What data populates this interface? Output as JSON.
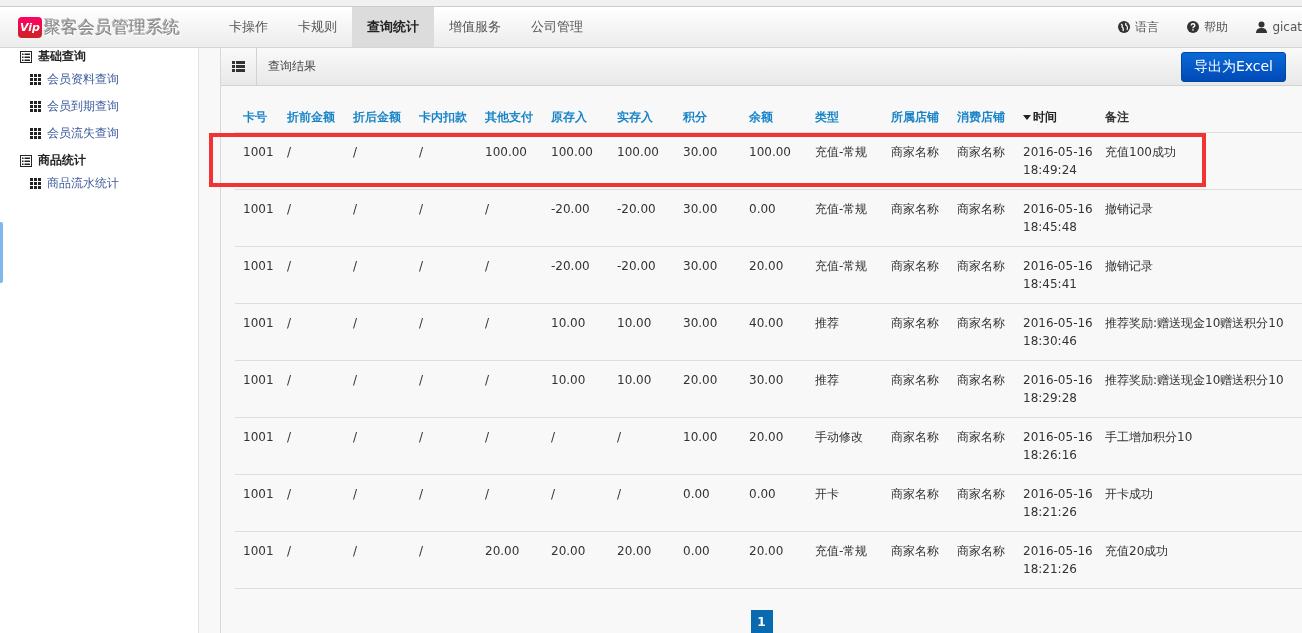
{
  "navbar": {
    "logo_badge": "Vip",
    "brand": "聚客会员管理系统",
    "tabs": [
      {
        "label": "卡操作",
        "selected": false
      },
      {
        "label": "卡规则",
        "selected": false
      },
      {
        "label": "查询统计",
        "selected": true
      },
      {
        "label": "增值服务",
        "selected": false
      },
      {
        "label": "公司管理",
        "selected": false
      }
    ],
    "right_items": [
      {
        "kind": "globe",
        "label": "语言"
      },
      {
        "kind": "help",
        "label": "帮助"
      },
      {
        "kind": "user",
        "label": "gicat"
      }
    ]
  },
  "sidebar": {
    "groups": [
      {
        "title": "基础查询",
        "items": [
          {
            "label": "会员资料查询"
          },
          {
            "label": "会员到期查询"
          },
          {
            "label": "会员流失查询"
          }
        ]
      },
      {
        "title": "商品统计",
        "items": [
          {
            "label": "商品流水统计"
          }
        ]
      }
    ]
  },
  "main": {
    "title": "查询结果",
    "export_button": "导出为Excel",
    "table": {
      "columns": [
        {
          "label": "卡号",
          "sortable": true,
          "sorted": false
        },
        {
          "label": "折前金额",
          "sortable": true,
          "sorted": false
        },
        {
          "label": "折后金额",
          "sortable": true,
          "sorted": false
        },
        {
          "label": "卡内扣款",
          "sortable": true,
          "sorted": false
        },
        {
          "label": "其他支付",
          "sortable": true,
          "sorted": false
        },
        {
          "label": "原存入",
          "sortable": true,
          "sorted": false
        },
        {
          "label": "实存入",
          "sortable": true,
          "sorted": false
        },
        {
          "label": "积分",
          "sortable": true,
          "sorted": false
        },
        {
          "label": "余额",
          "sortable": true,
          "sorted": false
        },
        {
          "label": "类型",
          "sortable": true,
          "sorted": false
        },
        {
          "label": "所属店铺",
          "sortable": true,
          "sorted": false
        },
        {
          "label": "消费店铺",
          "sortable": true,
          "sorted": false
        },
        {
          "label": "时间",
          "sortable": true,
          "sorted": true
        },
        {
          "label": "备注",
          "sortable": false,
          "sorted": false
        }
      ],
      "rows": [
        {
          "highlighted": true,
          "cells": [
            "1001",
            "/",
            "/",
            "/",
            "100.00",
            "100.00",
            "100.00",
            "30.00",
            "100.00",
            "充值-常规",
            "商家名称",
            "商家名称",
            "2016-05-16 18:49:24",
            "充值100成功"
          ]
        },
        {
          "highlighted": false,
          "cells": [
            "1001",
            "/",
            "/",
            "/",
            "/",
            "-20.00",
            "-20.00",
            "30.00",
            "0.00",
            "充值-常规",
            "商家名称",
            "商家名称",
            "2016-05-16 18:45:48",
            "撤销记录"
          ]
        },
        {
          "highlighted": false,
          "cells": [
            "1001",
            "/",
            "/",
            "/",
            "/",
            "-20.00",
            "-20.00",
            "30.00",
            "20.00",
            "充值-常规",
            "商家名称",
            "商家名称",
            "2016-05-16 18:45:41",
            "撤销记录"
          ]
        },
        {
          "highlighted": false,
          "cells": [
            "1001",
            "/",
            "/",
            "/",
            "/",
            "10.00",
            "10.00",
            "30.00",
            "40.00",
            "推荐",
            "商家名称",
            "商家名称",
            "2016-05-16 18:30:46",
            "推荐奖励:赠送现金10赠送积分10"
          ]
        },
        {
          "highlighted": false,
          "cells": [
            "1001",
            "/",
            "/",
            "/",
            "/",
            "10.00",
            "10.00",
            "20.00",
            "30.00",
            "推荐",
            "商家名称",
            "商家名称",
            "2016-05-16 18:29:28",
            "推荐奖励:赠送现金10赠送积分10"
          ]
        },
        {
          "highlighted": false,
          "cells": [
            "1001",
            "/",
            "/",
            "/",
            "/",
            "/",
            "/",
            "10.00",
            "20.00",
            "手动修改",
            "商家名称",
            "商家名称",
            "2016-05-16 18:26:16",
            "手工增加积分10"
          ]
        },
        {
          "highlighted": false,
          "cells": [
            "1001",
            "/",
            "/",
            "/",
            "/",
            "/",
            "/",
            "0.00",
            "0.00",
            "开卡",
            "商家名称",
            "商家名称",
            "2016-05-16 18:21:26",
            "开卡成功"
          ]
        },
        {
          "highlighted": false,
          "cells": [
            "1001",
            "/",
            "/",
            "/",
            "20.00",
            "20.00",
            "20.00",
            "0.00",
            "20.00",
            "充值-常规",
            "商家名称",
            "商家名称",
            "2016-05-16 18:21:26",
            "充值20成功"
          ]
        }
      ]
    },
    "pagination": [
      {
        "label": "1",
        "selected": true
      }
    ]
  }
}
